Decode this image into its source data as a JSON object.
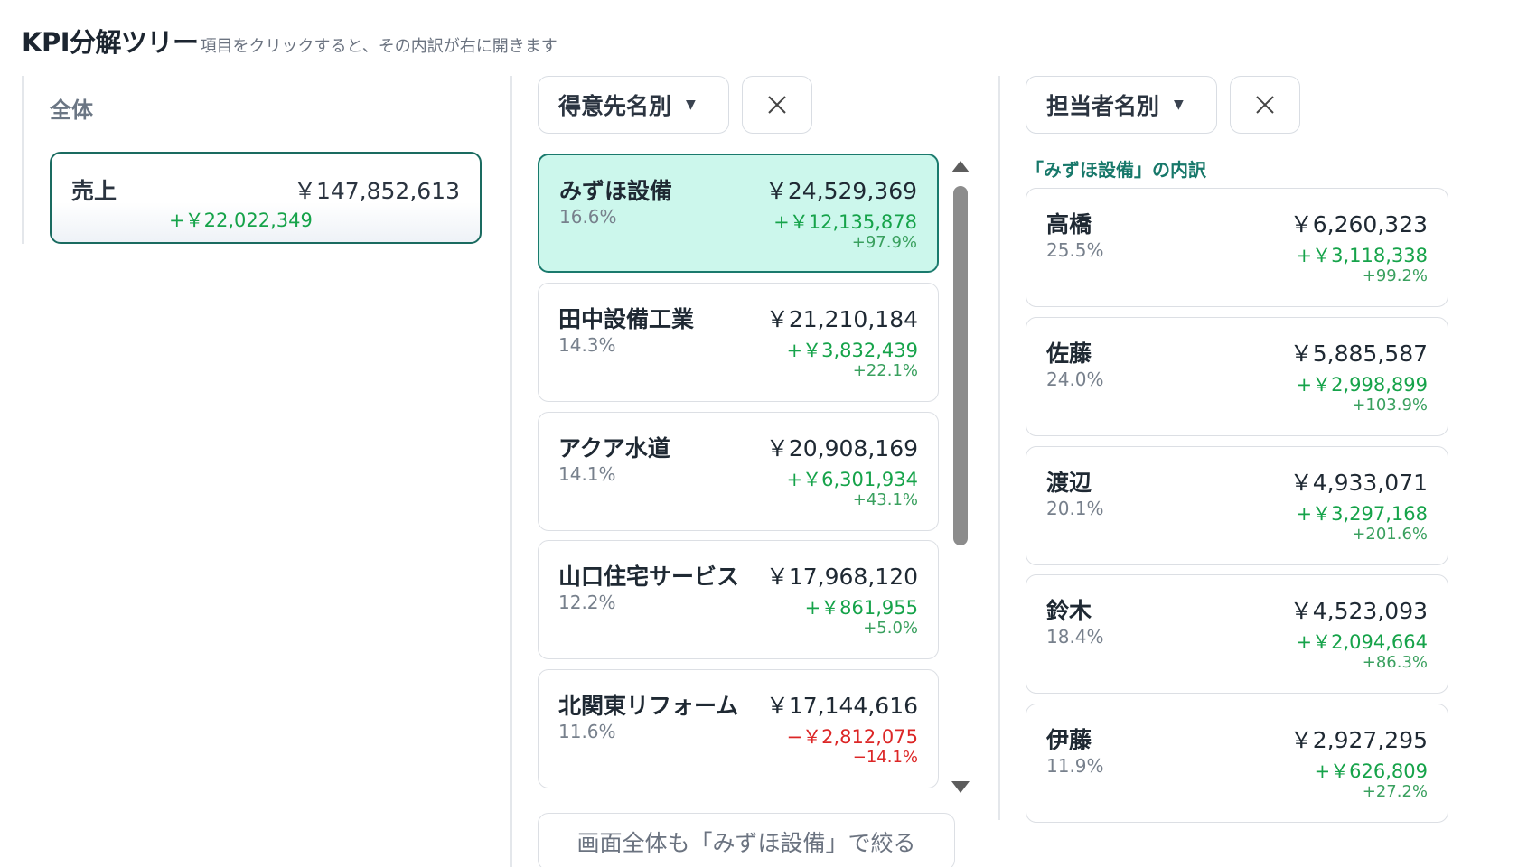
{
  "header": {
    "title": "KPI分解ツリー",
    "subtitle": "項目をクリックすると、その内訳が右に開きます"
  },
  "root": {
    "column_label": "全体",
    "name": "売上",
    "value": "￥147,852,613",
    "delta": "+￥22,022,349"
  },
  "customers": {
    "dropdown_label": "得意先名別",
    "filter_button": "画面全体も「みずほ設備」で絞る",
    "items": [
      {
        "name": "みずほ設備",
        "share": "16.6%",
        "value": "￥24,529,369",
        "delta": "+￥12,135,878",
        "pct": "+97.9%"
      },
      {
        "name": "田中設備工業",
        "share": "14.3%",
        "value": "￥21,210,184",
        "delta": "+￥3,832,439",
        "pct": "+22.1%"
      },
      {
        "name": "アクア水道",
        "share": "14.1%",
        "value": "￥20,908,169",
        "delta": "+￥6,301,934",
        "pct": "+43.1%"
      },
      {
        "name": "山口住宅サービス",
        "share": "12.2%",
        "value": "￥17,968,120",
        "delta": "+￥861,955",
        "pct": "+5.0%"
      },
      {
        "name": "北関東リフォーム",
        "share": "11.6%",
        "value": "￥17,144,616",
        "delta": "−￥2,812,075",
        "pct": "−14.1%"
      }
    ]
  },
  "staff": {
    "dropdown_label": "担当者名別",
    "breakdown_label": "「みずほ設備」の内訳",
    "items": [
      {
        "name": "高橋",
        "share": "25.5%",
        "value": "￥6,260,323",
        "delta": "+￥3,118,338",
        "pct": "+99.2%"
      },
      {
        "name": "佐藤",
        "share": "24.0%",
        "value": "￥5,885,587",
        "delta": "+￥2,998,899",
        "pct": "+103.9%"
      },
      {
        "name": "渡辺",
        "share": "20.1%",
        "value": "￥4,933,071",
        "delta": "+￥3,297,168",
        "pct": "+201.6%"
      },
      {
        "name": "鈴木",
        "share": "18.4%",
        "value": "￥4,523,093",
        "delta": "+￥2,094,664",
        "pct": "+86.3%"
      },
      {
        "name": "伊藤",
        "share": "11.9%",
        "value": "￥2,927,295",
        "delta": "+￥626,809",
        "pct": "+27.2%"
      }
    ]
  }
}
